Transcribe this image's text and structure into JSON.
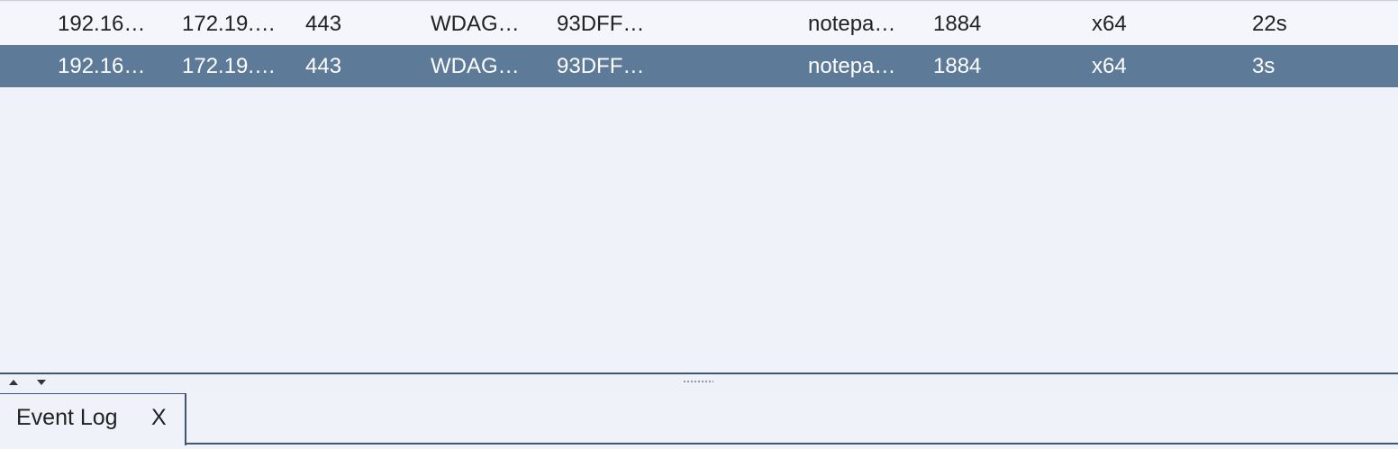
{
  "sessions": [
    {
      "icon": "windows-monitor-icon",
      "external": "192.16…",
      "internal": "172.19.…",
      "listener": "443",
      "user": "WDAG…",
      "computer": "93DFF…",
      "process": "notepa…",
      "pid": "1884",
      "arch": "x64",
      "last": "22s",
      "selected": false
    },
    {
      "icon": "windows-monitor-icon",
      "external": "192.16…",
      "internal": "172.19.…",
      "listener": "443",
      "user": "WDAG…",
      "computer": "93DFF…",
      "process": "notepa…",
      "pid": "1884",
      "arch": "x64",
      "last": "3s",
      "selected": true
    }
  ],
  "bottom_tabs": [
    {
      "label": "Event Log",
      "close": "X"
    }
  ],
  "colors": {
    "background": "#eff2f9",
    "selected_row": "#5d7a98",
    "accent_border": "#3f5575"
  }
}
